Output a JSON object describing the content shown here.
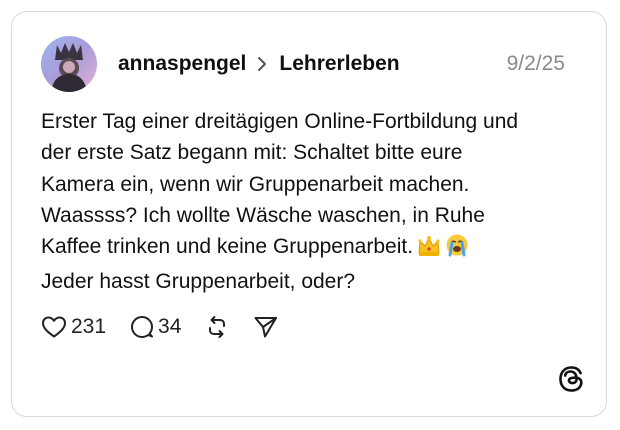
{
  "post": {
    "author": "annaspengel",
    "community": "Lehrerleben",
    "date": "9/2/25",
    "text_lines": [
      "Erster Tag einer dreitägigen Online-Fortbildung und",
      "der erste Satz begann mit: Schaltet bitte eure",
      "Kamera ein, wenn wir Gruppenarbeit machen.",
      "Waassss? Ich wollte Wäsche waschen, in Ruhe",
      "Kaffee trinken und keine Gruppenarbeit.",
      "Jeder hasst Gruppenarbeit, oder?"
    ],
    "emojis": [
      "crown-icon",
      "loudly-crying-face-icon"
    ]
  },
  "actions": {
    "likes": "231",
    "replies": "34"
  },
  "colors": {
    "border": "#d9d9d9",
    "date": "#8a8a8a",
    "text": "#111111"
  }
}
